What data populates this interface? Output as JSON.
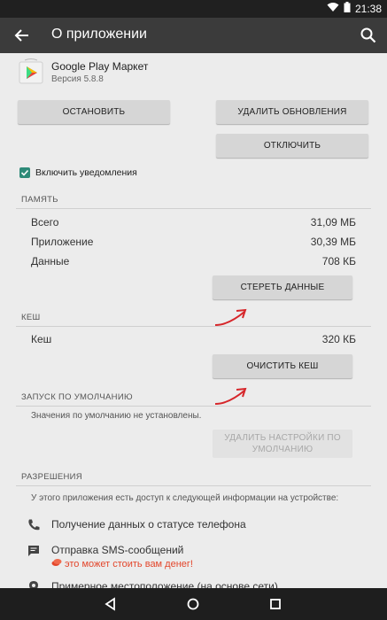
{
  "statusbar": {
    "time": "21:38"
  },
  "appbar": {
    "title": "О приложении"
  },
  "app": {
    "name": "Google Play Маркет",
    "version": "Версия 5.8.8"
  },
  "buttons": {
    "stop": "ОСТАНОВИТЬ",
    "uninstall_updates": "УДАЛИТЬ ОБНОВЛЕНИЯ",
    "disable": "ОТКЛЮЧИТЬ",
    "clear_data": "СТЕРЕТЬ ДАННЫЕ",
    "clear_cache": "ОЧИСТИТЬ КЕШ",
    "clear_defaults_line1": "УДАЛИТЬ НАСТРОЙКИ ПО",
    "clear_defaults_line2": "УМОЛЧАНИЮ"
  },
  "notifications": {
    "label": "Включить уведомления",
    "checked": true
  },
  "memory": {
    "header": "ПАМЯТЬ",
    "rows": [
      {
        "label": "Всего",
        "value": "31,09 МБ"
      },
      {
        "label": "Приложение",
        "value": "30,39 МБ"
      },
      {
        "label": "Данные",
        "value": "708 КБ"
      }
    ]
  },
  "cache": {
    "header": "КЕШ",
    "label": "Кеш",
    "value": "320 КБ"
  },
  "defaults": {
    "header": "ЗАПУСК ПО УМОЛЧАНИЮ",
    "text": "Значения по умолчанию не установлены."
  },
  "permissions": {
    "header": "РАЗРЕШЕНИЯ",
    "intro": "У этого приложения есть доступ к следующей информации на устройстве:",
    "items": [
      {
        "label": "Получение данных о статусе телефона",
        "icon": "phone-icon"
      },
      {
        "label": "Отправка SMS-сообщений",
        "warning": "это может стоить вам денег!",
        "icon": "message-icon"
      },
      {
        "label": "Примерное местоположение (на основе сети)",
        "icon": "location-icon"
      }
    ]
  },
  "colors": {
    "accent": "#2e8a78",
    "warning": "#e3462b",
    "annotation": "#d6262a"
  }
}
